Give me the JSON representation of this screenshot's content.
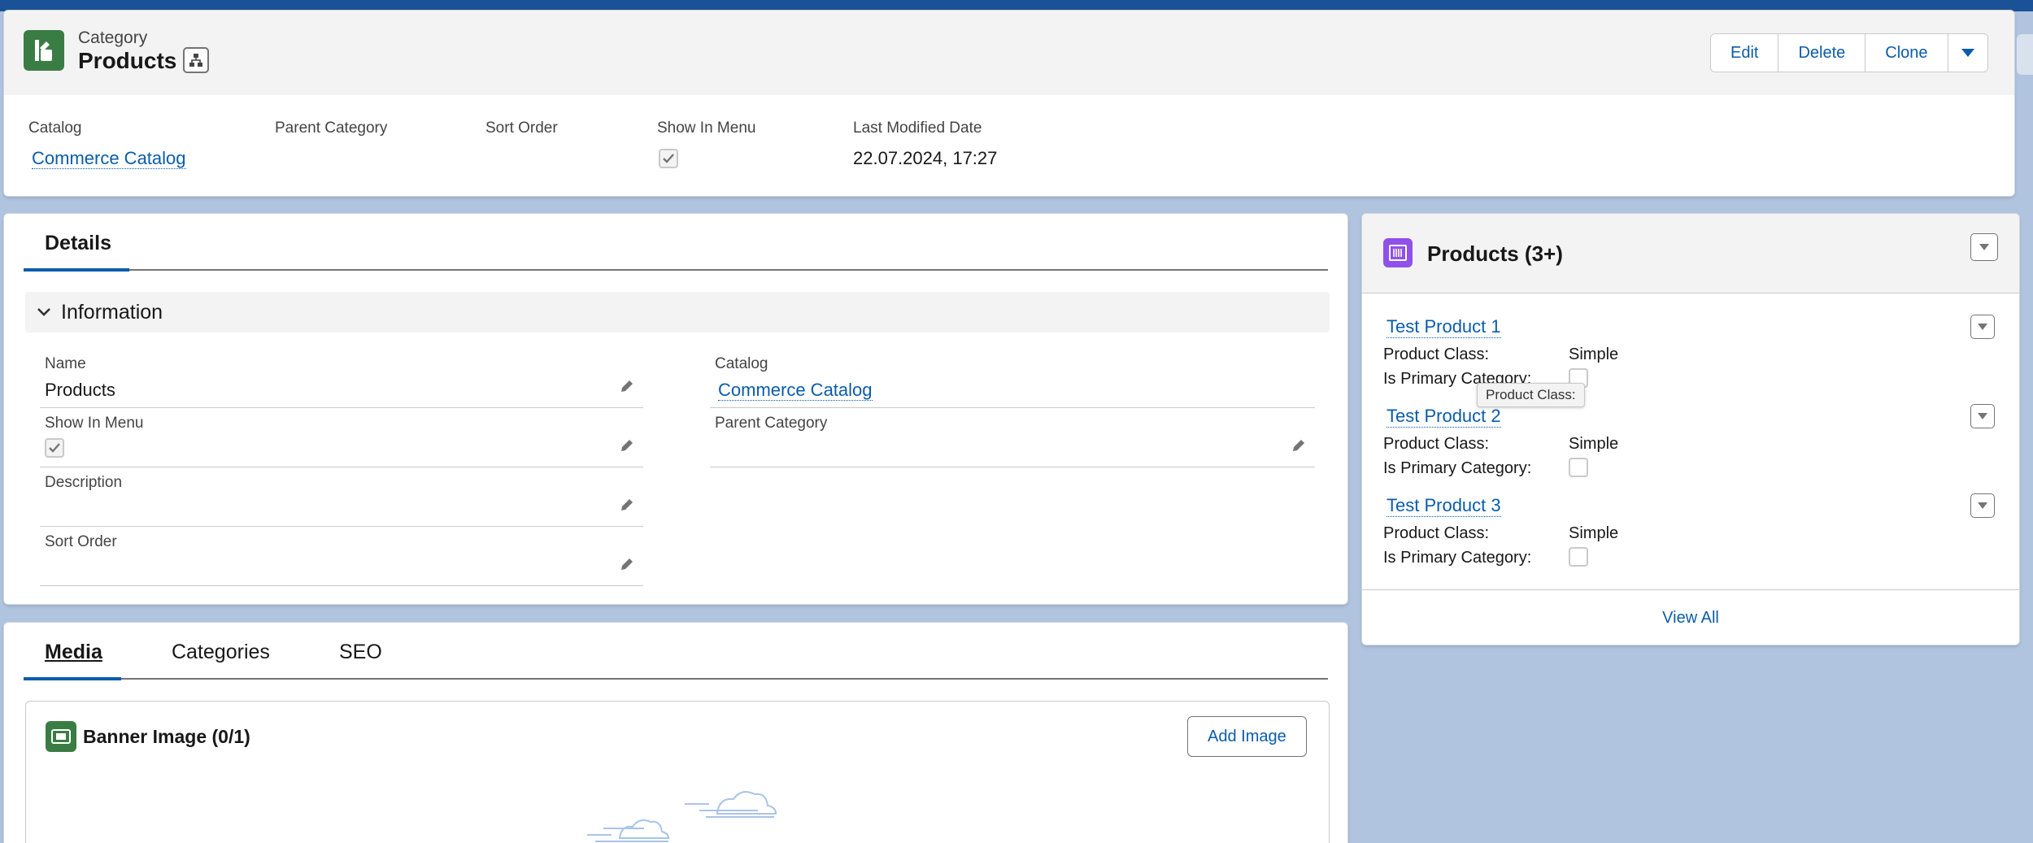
{
  "header": {
    "object_kind": "Category",
    "title": "Products",
    "buttons": {
      "edit": "Edit",
      "delete": "Delete",
      "clone": "Clone"
    },
    "fields": [
      {
        "label": "Catalog",
        "value": "Commerce Catalog"
      },
      {
        "label": "Parent Category",
        "value": ""
      },
      {
        "label": "Sort Order",
        "value": ""
      },
      {
        "label": "Show In Menu",
        "checked": true
      },
      {
        "label": "Last Modified Date",
        "value": "22.07.2024, 17:27"
      }
    ]
  },
  "details": {
    "tab": "Details",
    "section_title": "Information",
    "fields": {
      "name": {
        "label": "Name",
        "value": "Products"
      },
      "catalog": {
        "label": "Catalog",
        "value": "Commerce Catalog"
      },
      "show_in_menu": {
        "label": "Show In Menu",
        "checked": true
      },
      "parent_category": {
        "label": "Parent Category",
        "value": ""
      },
      "description": {
        "label": "Description",
        "value": ""
      },
      "sort_order": {
        "label": "Sort Order",
        "value": ""
      }
    }
  },
  "lower_tabs": {
    "tabs": [
      "Media",
      "Categories",
      "SEO"
    ],
    "active": "Media",
    "banner_title": "Banner Image (0/1)",
    "add_image": "Add Image"
  },
  "related": {
    "title": "Products (3+)",
    "class_label": "Product Class:",
    "primary_label": "Is Primary Category:",
    "products": [
      {
        "name": "Test Product 1",
        "class": "Simple",
        "primary": false
      },
      {
        "name": "Test Product 2",
        "class": "Simple",
        "primary": false
      },
      {
        "name": "Test Product 3",
        "class": "Simple",
        "primary": false
      }
    ],
    "view_all": "View All",
    "tooltip": "Product Class:"
  },
  "colors": {
    "brand_blue": "#0b5cab",
    "category_icon": "#3a7d44",
    "product_icon": "#9050e9",
    "background": "#b0c4df"
  }
}
